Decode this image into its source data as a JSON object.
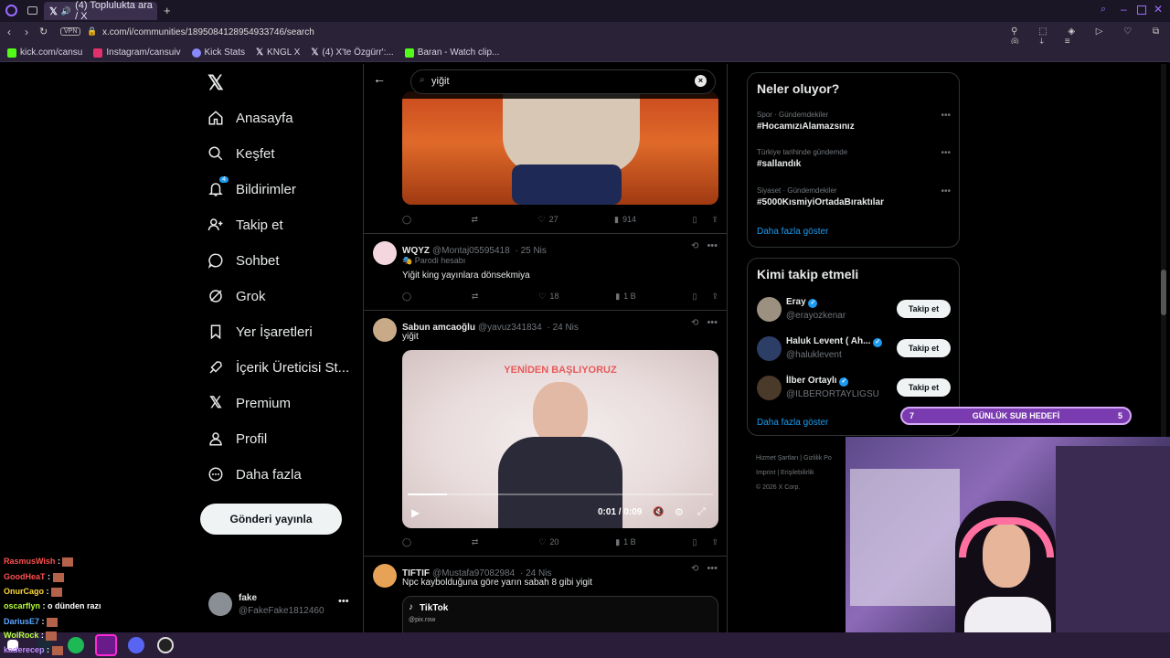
{
  "browser": {
    "tab_title": "(4) Toplulukta ara / X",
    "url": "x.com/i/communities/1895084128954933746/search",
    "vpn_label": "VPN",
    "bookmarks": [
      {
        "label": "kick.com/cansu",
        "color": "#53fc18"
      },
      {
        "label": "Instagram/cansuiv",
        "color": "#e1306c"
      },
      {
        "label": "Kick Stats",
        "color": "#8888ff"
      },
      {
        "label": "KNGL X",
        "color": "#ffffff"
      },
      {
        "label": "(4) X'te Özgürr':...",
        "color": "#ffffff"
      },
      {
        "label": "Baran - Watch clip...",
        "color": "#53fc18"
      }
    ]
  },
  "sidebar": {
    "items": [
      {
        "label": "Anasayfa",
        "icon": "home-icon"
      },
      {
        "label": "Keşfet",
        "icon": "search-icon"
      },
      {
        "label": "Bildirimler",
        "icon": "bell-icon",
        "badge": "4"
      },
      {
        "label": "Takip et",
        "icon": "add-person-icon"
      },
      {
        "label": "Sohbet",
        "icon": "chat-icon"
      },
      {
        "label": "Grok",
        "icon": "grok-icon"
      },
      {
        "label": "Yer İşaretleri",
        "icon": "bookmark-icon"
      },
      {
        "label": "İçerik Üreticisi St...",
        "icon": "rocket-icon"
      },
      {
        "label": "Premium",
        "icon": "x-icon"
      },
      {
        "label": "Profil",
        "icon": "person-icon"
      },
      {
        "label": "Daha fazla",
        "icon": "more-circle-icon"
      }
    ],
    "post_button": "Gönderi yayınla",
    "account": {
      "name": "fake",
      "handle": "@FakeFake1812460"
    }
  },
  "search": {
    "value": "yiğit"
  },
  "tweets": [
    {
      "actions": {
        "replies": "",
        "retweets": "",
        "likes": "27",
        "views": "914"
      }
    },
    {
      "name": "WQYZ",
      "handle": "@Montaj05595418",
      "time": "25 Nis",
      "badge": "Parodi hesabı",
      "text": "Yiğit king yayınlara dönsekmiya",
      "actions": {
        "replies": "",
        "retweets": "",
        "likes": "18",
        "views": "1 B"
      }
    },
    {
      "name": "Sabun amcaoğlu",
      "handle": "@yavuz341834",
      "time": "24 Nis",
      "text": "yiğit",
      "video": {
        "overlay_text": "YENİDEN BAŞLIYORUZ",
        "time": "0:01 / 0:09",
        "progress": 0.13
      },
      "actions": {
        "replies": "",
        "retweets": "",
        "likes": "20",
        "views": "1 B"
      }
    },
    {
      "name": "TIFTIF",
      "handle": "@Mustafa97082984",
      "time": "24 Nis",
      "text": "Npc kaybolduğuna göre yarın sabah 8 gibi yigit",
      "embed": {
        "title": "TikTok",
        "handle": "@pix.row"
      }
    }
  ],
  "trends": {
    "title": "Neler oluyor?",
    "items": [
      {
        "category": "Spor · Gündemdekiler",
        "tag": "#HocamızıAlamazsınız"
      },
      {
        "category": "Türkiye tarihinde gündemde",
        "tag": "#sallandık"
      },
      {
        "category": "Siyaset · Gündemdekiler",
        "tag": "#5000KısmiyiOrtadaBıraktılar"
      }
    ],
    "show_more": "Daha fazla göster"
  },
  "who_to_follow": {
    "title": "Kimi takip etmeli",
    "users": [
      {
        "name": "Eray",
        "handle": "@erayozkenar"
      },
      {
        "name": "Haluk Levent ( Ah...",
        "handle": "@haluklevent"
      },
      {
        "name": "İlber Ortaylı",
        "handle": "@ILBERORTAYLIGSU"
      }
    ],
    "follow_label": "Takip et",
    "show_more": "Daha fazla göster"
  },
  "footer": {
    "links": [
      "Hizmet Şartları",
      "Gizlilik Po",
      "Imprint",
      "Erişilebilirlik"
    ],
    "copyright": "© 2026 X Corp."
  },
  "stream": {
    "sub_goal": {
      "current": "7",
      "label": "GÜNLÜK SUB HEDEFİ",
      "target": "5"
    },
    "chat": [
      {
        "user": "RasmusWish",
        "msg": "",
        "color": "#ff4f4f"
      },
      {
        "user": "GoodHeaT",
        "msg": "",
        "color": "#ff4f4f"
      },
      {
        "user": "OnurCago",
        "msg": "",
        "color": "#ffd93b"
      },
      {
        "user": "oscarflyn",
        "msg": "o dünden razı",
        "color": "#b5ff3b"
      },
      {
        "user": "DariusE7",
        "msg": "",
        "color": "#5aa7ff"
      },
      {
        "user": "WolRock",
        "msg": "",
        "color": "#b5ff3b"
      },
      {
        "user": "kaderecep",
        "msg": "",
        "color": "#c18bff"
      }
    ]
  }
}
